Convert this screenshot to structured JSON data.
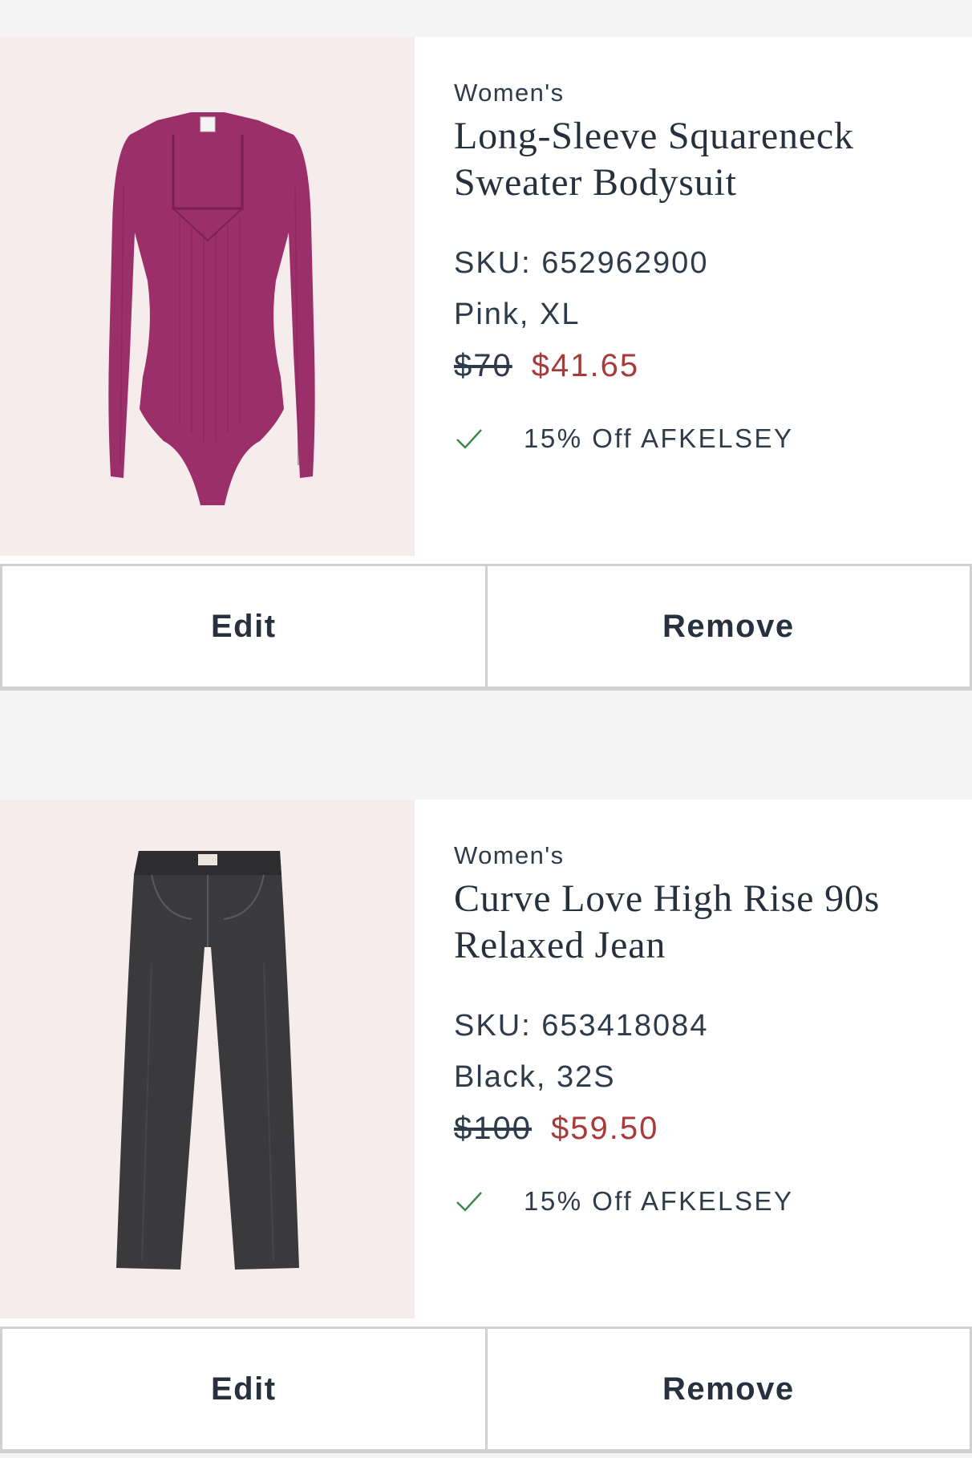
{
  "items": [
    {
      "gender": "Women's",
      "name_line1": "Long-Sleeve Squareneck",
      "name_line2": "Sweater Bodysuit",
      "sku": "SKU: 652962900",
      "variant": "Pink, XL",
      "original_price": "$70",
      "sale_price": "$41.65",
      "promo": "15% Off AFKELSEY",
      "edit_label": "Edit",
      "remove_label": "Remove",
      "image_icon": "pink-bodysuit-image",
      "product_color": "#9b2f6a"
    },
    {
      "gender": "Women's",
      "name_line1": "Curve Love High Rise 90s",
      "name_line2": "Relaxed Jean",
      "sku": "SKU: 653418084",
      "variant": "Black, 32S",
      "original_price": "$100",
      "sale_price": "$59.50",
      "promo": "15% Off AFKELSEY",
      "edit_label": "Edit",
      "remove_label": "Remove",
      "image_icon": "black-jeans-image",
      "product_color": "#3a3a3c"
    }
  ],
  "colors": {
    "sale_price": "#a83a3a",
    "check": "#3c8a4a",
    "text": "#2e3b4a",
    "image_bg": "#f7ecec",
    "page_bg": "#f4f4f4"
  }
}
